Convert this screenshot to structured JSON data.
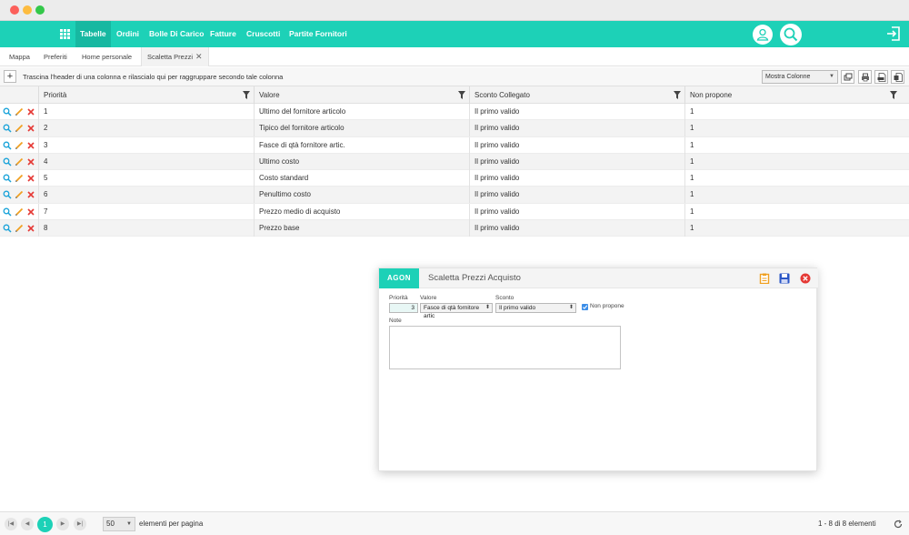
{
  "nav": {
    "tabs": [
      {
        "label": "Tabelle"
      },
      {
        "label": "Ordini"
      },
      {
        "label": "Bolle Di Carico"
      },
      {
        "label": "Fatture"
      },
      {
        "label": "Cruscotti"
      },
      {
        "label": "Partite Fornitori"
      }
    ],
    "active_tab": "Tabelle",
    "accent_color": "#1dd1b7"
  },
  "subtabs": {
    "items": [
      {
        "label": "Mappa"
      },
      {
        "label": "Preferiti"
      },
      {
        "label": "Home personale"
      },
      {
        "label": "Scaletta Prezzi"
      }
    ],
    "active": "Scaletta Prezzi"
  },
  "toolbar": {
    "add_label": "+",
    "group_hint": "Trascina l'header di una colonna e rilascialo qui per raggruppare secondo tale colonna",
    "columns_select": "Mostra Colonne"
  },
  "grid": {
    "columns": [
      "Priorità",
      "Valore",
      "Sconto Collegato",
      "Non propone"
    ],
    "rows": [
      [
        "1",
        "Ultimo del fornitore articolo",
        "Il primo valido",
        "1"
      ],
      [
        "2",
        "Tipico del fornitore articolo",
        "Il primo valido",
        "1"
      ],
      [
        "3",
        "Fasce di qtà fornitore artic.",
        "Il primo valido",
        "1"
      ],
      [
        "4",
        "Ultimo costo",
        "Il primo valido",
        "1"
      ],
      [
        "5",
        "Costo standard",
        "Il primo valido",
        "1"
      ],
      [
        "6",
        "Penultimo costo",
        "Il primo valido",
        "1"
      ],
      [
        "7",
        "Prezzo medio di acquisto",
        "Il primo valido",
        "1"
      ],
      [
        "8",
        "Prezzo base",
        "Il primo valido",
        "1"
      ]
    ]
  },
  "modal": {
    "logo": "AGON",
    "title": "Scaletta Prezzi Acquisto",
    "fields": {
      "priority_label": "Priorità",
      "priority_value": "3",
      "value_label": "Valore",
      "value_selected": "Fasce di qtà fornitore artic",
      "discount_label": "Sconto",
      "discount_selected": "Il primo valido",
      "non_propone_label": "Non propone",
      "non_propone_checked": true,
      "notes_label": "Note",
      "notes_value": ""
    }
  },
  "footer": {
    "current_page": "1",
    "page_size": "50",
    "page_size_label": "elementi per pagina",
    "info": "1 - 8 di 8 elementi"
  }
}
